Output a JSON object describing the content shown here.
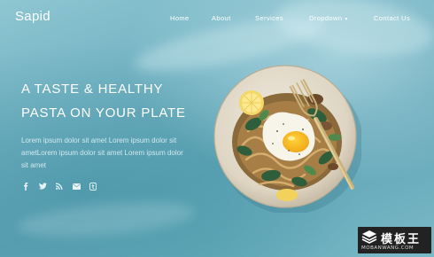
{
  "brand": "Sapid",
  "nav": {
    "items": [
      {
        "label": "Home"
      },
      {
        "label": "About"
      },
      {
        "label": "Services"
      },
      {
        "label": "Dropdown"
      },
      {
        "label": "Contact Us"
      }
    ]
  },
  "hero": {
    "headline_line1": "A TASTE & HEALTHY",
    "headline_line2": "PASTA ON YOUR PLATE",
    "body": "Lorem ipsum dolor sit amet Lorem ipsum dolor sit ametLorem ipsum dolor sit amet Lorem ipsum dolor sit amet",
    "social_icons": [
      "facebook-icon",
      "twitter-icon",
      "rss-icon",
      "mail-icon",
      "tumblr-icon"
    ]
  },
  "watermark": {
    "title": "模板王",
    "url": "MOBANWANG.COM"
  },
  "colors": {
    "background": "#7ab7c5",
    "text": "#ffffff",
    "plate": "#e9e2d3",
    "watermark_bg": "#222222"
  }
}
